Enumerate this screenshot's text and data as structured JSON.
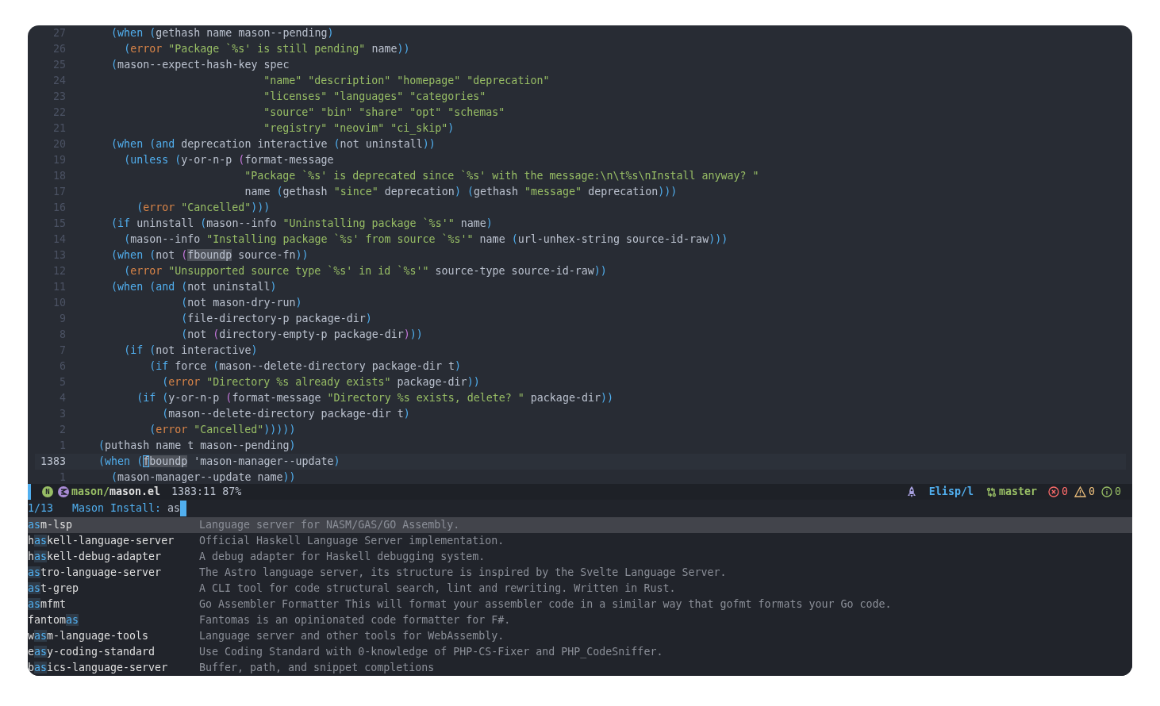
{
  "editor": {
    "lines": [
      {
        "number": "27",
        "current": false,
        "segments": [
          {
            "kind": "plain",
            "text": "      ("
          },
          {
            "kind": "keyword",
            "text": "when"
          },
          {
            "kind": "plain",
            "text": " (gethash name mason--pending)"
          }
        ]
      },
      {
        "number": "26",
        "current": false,
        "segments": [
          {
            "kind": "plain",
            "text": "        ("
          },
          {
            "kind": "builtin",
            "text": "error"
          },
          {
            "kind": "string",
            "text": " \"Package `%s' is still pending\""
          },
          {
            "kind": "plain",
            "text": " name))"
          }
        ]
      },
      {
        "number": "25",
        "current": false,
        "segments": [
          {
            "kind": "plain",
            "text": "      (mason--expect-hash-key spec"
          }
        ]
      },
      {
        "number": "24",
        "current": false,
        "segments": [
          {
            "kind": "string",
            "text": "                              \"name\" \"description\" \"homepage\" \"deprecation\""
          }
        ]
      },
      {
        "number": "23",
        "current": false,
        "segments": [
          {
            "kind": "string",
            "text": "                              \"licenses\" \"languages\" \"categories\""
          }
        ]
      },
      {
        "number": "22",
        "current": false,
        "segments": [
          {
            "kind": "string",
            "text": "                              \"source\" \"bin\" \"share\" \"opt\" \"schemas\""
          }
        ]
      },
      {
        "number": "21",
        "current": false,
        "segments": [
          {
            "kind": "string",
            "text": "                              \"registry\" \"neovim\" \"ci_skip\""
          },
          {
            "kind": "plain",
            "text": ")"
          }
        ]
      },
      {
        "number": "20",
        "current": false,
        "segments": [
          {
            "kind": "plain",
            "text": "      ("
          },
          {
            "kind": "keyword",
            "text": "when"
          },
          {
            "kind": "plain",
            "text": " ("
          },
          {
            "kind": "keyword",
            "text": "and"
          },
          {
            "kind": "plain",
            "text": " deprecation interactive (not uninstall))"
          }
        ]
      },
      {
        "number": "19",
        "current": false,
        "segments": [
          {
            "kind": "plain",
            "text": "        ("
          },
          {
            "kind": "keyword",
            "text": "unless"
          },
          {
            "kind": "plain",
            "text": " (y-or-n-p (format-message"
          }
        ]
      },
      {
        "number": "18",
        "current": false,
        "segments": [
          {
            "kind": "string",
            "text": "                           \"Package `%s' is deprecated since `%s' with the message:\\n\\t%s\\nInstall anyway? \""
          }
        ]
      },
      {
        "number": "17",
        "current": false,
        "segments": [
          {
            "kind": "plain",
            "text": "                           name (gethash "
          },
          {
            "kind": "string",
            "text": "\"since\""
          },
          {
            "kind": "plain",
            "text": " deprecation) (gethash "
          },
          {
            "kind": "string",
            "text": "\"message\""
          },
          {
            "kind": "plain",
            "text": " deprecation)))"
          }
        ]
      },
      {
        "number": "16",
        "current": false,
        "segments": [
          {
            "kind": "plain",
            "text": "          ("
          },
          {
            "kind": "builtin",
            "text": "error"
          },
          {
            "kind": "string",
            "text": " \"Cancelled\""
          },
          {
            "kind": "plain",
            "text": ")))"
          }
        ]
      },
      {
        "number": "15",
        "current": false,
        "segments": [
          {
            "kind": "plain",
            "text": "      ("
          },
          {
            "kind": "keyword",
            "text": "if"
          },
          {
            "kind": "plain",
            "text": " uninstall (mason--info "
          },
          {
            "kind": "string",
            "text": "\"Uninstalling package `%s'\""
          },
          {
            "kind": "plain",
            "text": " name)"
          }
        ]
      },
      {
        "number": "14",
        "current": false,
        "segments": [
          {
            "kind": "plain",
            "text": "        (mason--info "
          },
          {
            "kind": "string",
            "text": "\"Installing package `%s' from source `%s'\""
          },
          {
            "kind": "plain",
            "text": " name (url-unhex-string source-id-raw)))"
          }
        ]
      },
      {
        "number": "13",
        "current": false,
        "segments": [
          {
            "kind": "plain",
            "text": "      ("
          },
          {
            "kind": "keyword",
            "text": "when"
          },
          {
            "kind": "plain",
            "text": " (not ("
          },
          {
            "kind": "match",
            "text": "fboundp"
          },
          {
            "kind": "plain",
            "text": " source-fn))"
          }
        ]
      },
      {
        "number": "12",
        "current": false,
        "segments": [
          {
            "kind": "plain",
            "text": "        ("
          },
          {
            "kind": "builtin",
            "text": "error"
          },
          {
            "kind": "string",
            "text": " \"Unsupported source type `%s' in id `%s'\""
          },
          {
            "kind": "plain",
            "text": " source-type source-id-raw))"
          }
        ]
      },
      {
        "number": "11",
        "current": false,
        "segments": [
          {
            "kind": "plain",
            "text": "      ("
          },
          {
            "kind": "keyword",
            "text": "when"
          },
          {
            "kind": "plain",
            "text": " ("
          },
          {
            "kind": "keyword",
            "text": "and"
          },
          {
            "kind": "plain",
            "text": " (not uninstall)"
          }
        ]
      },
      {
        "number": "10",
        "current": false,
        "segments": [
          {
            "kind": "plain",
            "text": "                 (not mason-dry-run)"
          }
        ]
      },
      {
        "number": "9",
        "current": false,
        "segments": [
          {
            "kind": "plain",
            "text": "                 (file-directory-p package-dir)"
          }
        ]
      },
      {
        "number": "8",
        "current": false,
        "segments": [
          {
            "kind": "plain",
            "text": "                 (not (directory-empty-p package-dir)))"
          }
        ]
      },
      {
        "number": "7",
        "current": false,
        "segments": [
          {
            "kind": "plain",
            "text": "        ("
          },
          {
            "kind": "keyword",
            "text": "if"
          },
          {
            "kind": "plain",
            "text": " (not interactive)"
          }
        ]
      },
      {
        "number": "6",
        "current": false,
        "segments": [
          {
            "kind": "plain",
            "text": "            ("
          },
          {
            "kind": "keyword",
            "text": "if"
          },
          {
            "kind": "plain",
            "text": " force (mason--delete-directory package-dir t)"
          }
        ]
      },
      {
        "number": "5",
        "current": false,
        "segments": [
          {
            "kind": "plain",
            "text": "              ("
          },
          {
            "kind": "builtin",
            "text": "error"
          },
          {
            "kind": "string",
            "text": " \"Directory %s already exists\""
          },
          {
            "kind": "plain",
            "text": " package-dir))"
          }
        ]
      },
      {
        "number": "4",
        "current": false,
        "segments": [
          {
            "kind": "plain",
            "text": "          ("
          },
          {
            "kind": "keyword",
            "text": "if"
          },
          {
            "kind": "plain",
            "text": " (y-or-n-p (format-message "
          },
          {
            "kind": "string",
            "text": "\"Directory %s exists, delete? \""
          },
          {
            "kind": "plain",
            "text": " package-dir))"
          }
        ]
      },
      {
        "number": "3",
        "current": false,
        "segments": [
          {
            "kind": "plain",
            "text": "              (mason--delete-directory package-dir t)"
          }
        ]
      },
      {
        "number": "2",
        "current": false,
        "segments": [
          {
            "kind": "plain",
            "text": "            ("
          },
          {
            "kind": "builtin",
            "text": "error"
          },
          {
            "kind": "string",
            "text": " \"Cancelled\""
          },
          {
            "kind": "plain",
            "text": ")))))"
          }
        ]
      },
      {
        "number": "1",
        "current": false,
        "segments": [
          {
            "kind": "plain",
            "text": "    (puthash name t mason--pending)"
          }
        ]
      },
      {
        "number": "1383",
        "current": true,
        "segments": [
          {
            "kind": "plain",
            "text": "    ("
          },
          {
            "kind": "keyword",
            "text": "when"
          },
          {
            "kind": "plain",
            "text": " ("
          },
          {
            "kind": "cursor",
            "text": "f"
          },
          {
            "kind": "match",
            "text": "boundp"
          },
          {
            "kind": "plain",
            "text": " 'mason-manager--update)"
          }
        ]
      },
      {
        "number": "1",
        "current": false,
        "segments": [
          {
            "kind": "plain",
            "text": "      (mason-manager--update name))"
          }
        ]
      }
    ]
  },
  "mode_line": {
    "state": "N",
    "directory": "mason/",
    "file": "mason.el",
    "position": "1383:11",
    "percent": "87%",
    "major_mode": "Elisp/l",
    "branch": "master",
    "errors": "0",
    "warnings": "0",
    "infos": "0"
  },
  "minibuffer": {
    "count": "1/13",
    "prompt": "Mason Install:",
    "input": "as"
  },
  "completions": [
    {
      "selected": true,
      "match": "as",
      "suffix": "m-lsp",
      "description": "Language server for NASM/GAS/GO Assembly."
    },
    {
      "selected": false,
      "prefix": "h",
      "match": "as",
      "suffix": "kell-language-server",
      "description": "Official Haskell Language Server implementation."
    },
    {
      "selected": false,
      "prefix": "h",
      "match": "as",
      "suffix": "kell-debug-adapter",
      "description": "A debug adapter for Haskell debugging system."
    },
    {
      "selected": false,
      "match": "as",
      "suffix": "tro-language-server",
      "description": "The Astro language server, its structure is inspired by the Svelte Language Server."
    },
    {
      "selected": false,
      "match": "as",
      "suffix": "t-grep",
      "description": "A CLI tool for code structural search, lint and rewriting. Written in Rust."
    },
    {
      "selected": false,
      "match": "as",
      "suffix": "mfmt",
      "description": "Go Assembler Formatter This will format your assembler code in a similar way that gofmt formats your Go code."
    },
    {
      "selected": false,
      "prefix": "fantom",
      "match": "as",
      "description": "Fantomas is an opinionated code formatter for F#."
    },
    {
      "selected": false,
      "prefix": "w",
      "match": "as",
      "suffix": "m-language-tools",
      "description": "Language server and other tools for WebAssembly."
    },
    {
      "selected": false,
      "prefix": "e",
      "match": "as",
      "suffix": "y-coding-standard",
      "description": "Use Coding Standard with 0-knowledge of PHP-CS-Fixer and PHP_CodeSniffer."
    },
    {
      "selected": false,
      "prefix": "b",
      "match": "as",
      "suffix": "ics-language-server",
      "description": "Buffer, path, and snippet completions"
    }
  ]
}
